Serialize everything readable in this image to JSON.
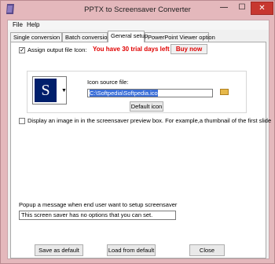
{
  "window": {
    "title": "PPTX to Screensaver Converter",
    "min_glyph": "—",
    "max_glyph": "☐",
    "close_glyph": "✕"
  },
  "menu": [
    "File",
    "Help"
  ],
  "tabs": [
    {
      "label": "Single conversion",
      "active": false
    },
    {
      "label": "Batch conversion",
      "active": false
    },
    {
      "label": "General setup",
      "active": true
    },
    {
      "label": "PowerPoint Viewer option",
      "active": false
    }
  ],
  "general": {
    "assign_icon_label": "Assign output file Icon:",
    "trial_text": "You have 30 trial days left",
    "buy_label": "Buy now",
    "icon_source_label": "Icon source file:",
    "icon_source_value": "C:\\Softpedia\\Softpedia.ico",
    "default_icon_label": "Default icon",
    "preview_letter": "S",
    "dropdown_glyph": "▼",
    "display_image_label": "Display an image in in the screensaver preview box. For example,a  thumbnail of the first slide",
    "popup_label": "Popup a message when end user want to setup screensaver",
    "popup_value": "This screen saver has no options that you can set."
  },
  "buttons": {
    "save": "Save as default",
    "load": "Load from default",
    "close": "Close"
  }
}
